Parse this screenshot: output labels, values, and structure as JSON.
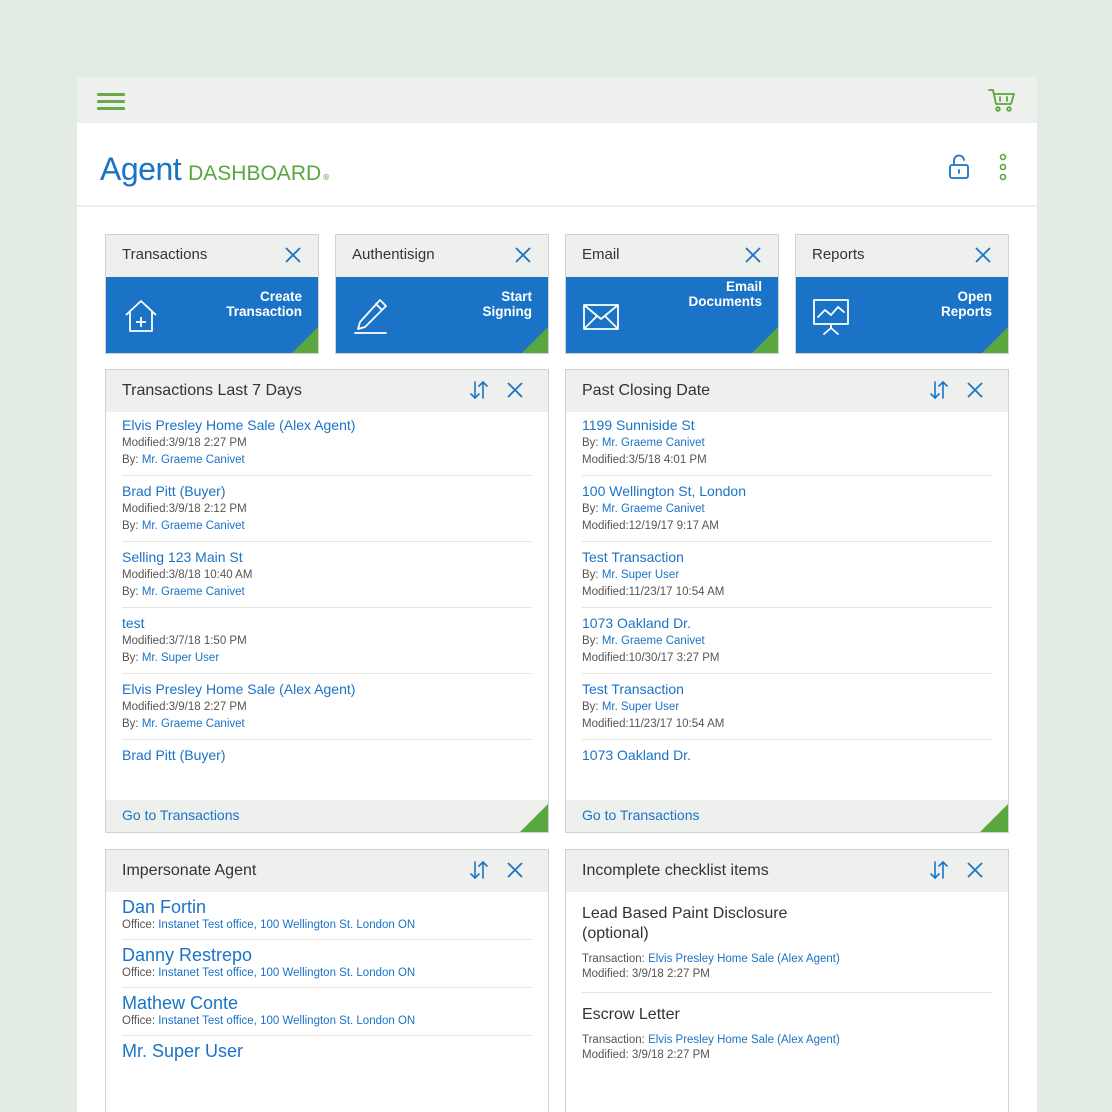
{
  "brand": {
    "agent": "Agent",
    "dashboard": "DASHBOARD",
    "reg": "®"
  },
  "colors": {
    "blue": "#1a73c7",
    "green": "#5aa63f",
    "panel": "#eef0ee"
  },
  "icons": {
    "menu": "hamburger-icon",
    "cart": "cart-icon",
    "lock": "lock-icon",
    "more": "kebab-icon"
  },
  "tiles": [
    {
      "title": "Transactions",
      "action": "Create\nTransaction",
      "icon": "house-plus-icon"
    },
    {
      "title": "Authentisign",
      "action": "Start\nSigning",
      "icon": "pen-icon"
    },
    {
      "title": "Email",
      "action": "Email\nDocuments",
      "icon": "envelope-icon"
    },
    {
      "title": "Reports",
      "action": "Open\nReports",
      "icon": "presentation-icon"
    }
  ],
  "recent": {
    "title": "Transactions Last 7 Days",
    "footer": "Go to Transactions",
    "items": [
      {
        "title": "Elvis Presley Home Sale (Alex Agent)",
        "modified": "Modified:3/9/18 2:27 PM",
        "by_label": "By:",
        "by": "Mr. Graeme Canivet"
      },
      {
        "title": "Brad Pitt (Buyer)",
        "modified": "Modified:3/9/18 2:12 PM",
        "by_label": "By:",
        "by": "Mr. Graeme Canivet"
      },
      {
        "title": "Selling 123 Main St",
        "modified": "Modified:3/8/18 10:40 AM",
        "by_label": "By:",
        "by": "Mr. Graeme Canivet"
      },
      {
        "title": "test",
        "modified": "Modified:3/7/18 1:50 PM",
        "by_label": "By:",
        "by": "Mr. Super User"
      },
      {
        "title": "Elvis Presley Home Sale (Alex Agent)",
        "modified": "Modified:3/9/18 2:27 PM",
        "by_label": "By:",
        "by": "Mr. Graeme Canivet"
      },
      {
        "title": "Brad Pitt (Buyer)",
        "modified": "",
        "by_label": "",
        "by": ""
      }
    ]
  },
  "past": {
    "title": "Past Closing Date",
    "footer": "Go to Transactions",
    "items": [
      {
        "title": "1199 Sunniside St",
        "by_label": "By:",
        "by": "Mr. Graeme Canivet",
        "modified": "Modified:3/5/18 4:01 PM"
      },
      {
        "title": "100 Wellington St, London",
        "by_label": "By:",
        "by": "Mr. Graeme Canivet",
        "modified": "Modified:12/19/17 9:17 AM"
      },
      {
        "title": "Test Transaction",
        "by_label": "By:",
        "by": "Mr. Super User",
        "modified": "Modified:11/23/17 10:54 AM"
      },
      {
        "title": "1073 Oakland Dr.",
        "by_label": "By:",
        "by": "Mr. Graeme Canivet",
        "modified": "Modified:10/30/17 3:27 PM"
      },
      {
        "title": "Test Transaction",
        "by_label": "By:",
        "by": "Mr. Super User",
        "modified": "Modified:11/23/17 10:54 AM"
      },
      {
        "title": "1073 Oakland Dr.",
        "by_label": "",
        "by": "",
        "modified": ""
      }
    ]
  },
  "impersonate": {
    "title": "Impersonate Agent",
    "agents": [
      {
        "name": "Dan Fortin",
        "office_label": "Office:",
        "office": "Instanet Test office, 100 Wellington St. London ON"
      },
      {
        "name": "Danny Restrepo",
        "office_label": "Office:",
        "office": "Instanet Test office, 100 Wellington St. London ON"
      },
      {
        "name": "Mathew Conte",
        "office_label": "Office:",
        "office": "Instanet Test office, 100 Wellington St. London ON"
      },
      {
        "name": "Mr. Super User",
        "office_label": "",
        "office": ""
      }
    ]
  },
  "checklist": {
    "title": "Incomplete checklist items",
    "items": [
      {
        "title": "Lead Based Paint Disclosure (optional)",
        "tx_label": "Transaction:",
        "tx": "Elvis Presley Home Sale (Alex Agent)",
        "modified": "Modified: 3/9/18 2:27 PM"
      },
      {
        "title": "Escrow Letter",
        "tx_label": "Transaction:",
        "tx": "Elvis Presley Home Sale (Alex Agent)",
        "modified": "Modified: 3/9/18 2:27 PM"
      }
    ]
  }
}
